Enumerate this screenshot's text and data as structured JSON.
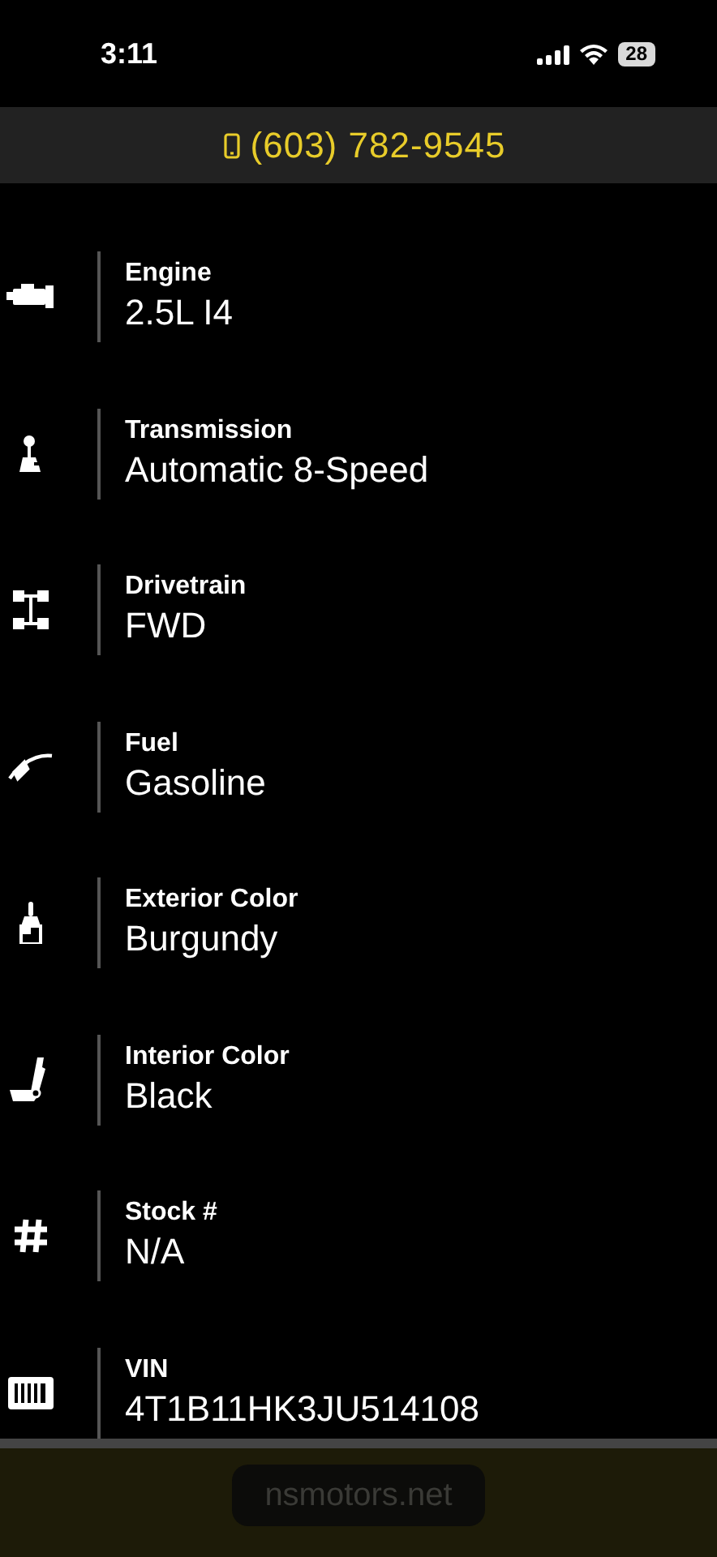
{
  "status_bar": {
    "time": "3:11",
    "battery": "28"
  },
  "phone": {
    "number": "(603) 782-9545"
  },
  "specs": [
    {
      "kind": "engine",
      "label": "Engine",
      "value": "2.5L I4"
    },
    {
      "kind": "transmission",
      "label": "Transmission",
      "value": "Automatic 8-Speed"
    },
    {
      "kind": "drivetrain",
      "label": "Drivetrain",
      "value": "FWD"
    },
    {
      "kind": "fuel",
      "label": "Fuel",
      "value": "Gasoline"
    },
    {
      "kind": "paint",
      "label": "Exterior Color",
      "value": "Burgundy"
    },
    {
      "kind": "seat",
      "label": "Interior Color",
      "value": "Black"
    },
    {
      "kind": "hash",
      "label": "Stock #",
      "value": "N/A"
    },
    {
      "kind": "barcode",
      "label": "VIN",
      "value": "4T1B11HK3JU514108"
    }
  ],
  "browser": {
    "url": "nsmotors.net"
  }
}
